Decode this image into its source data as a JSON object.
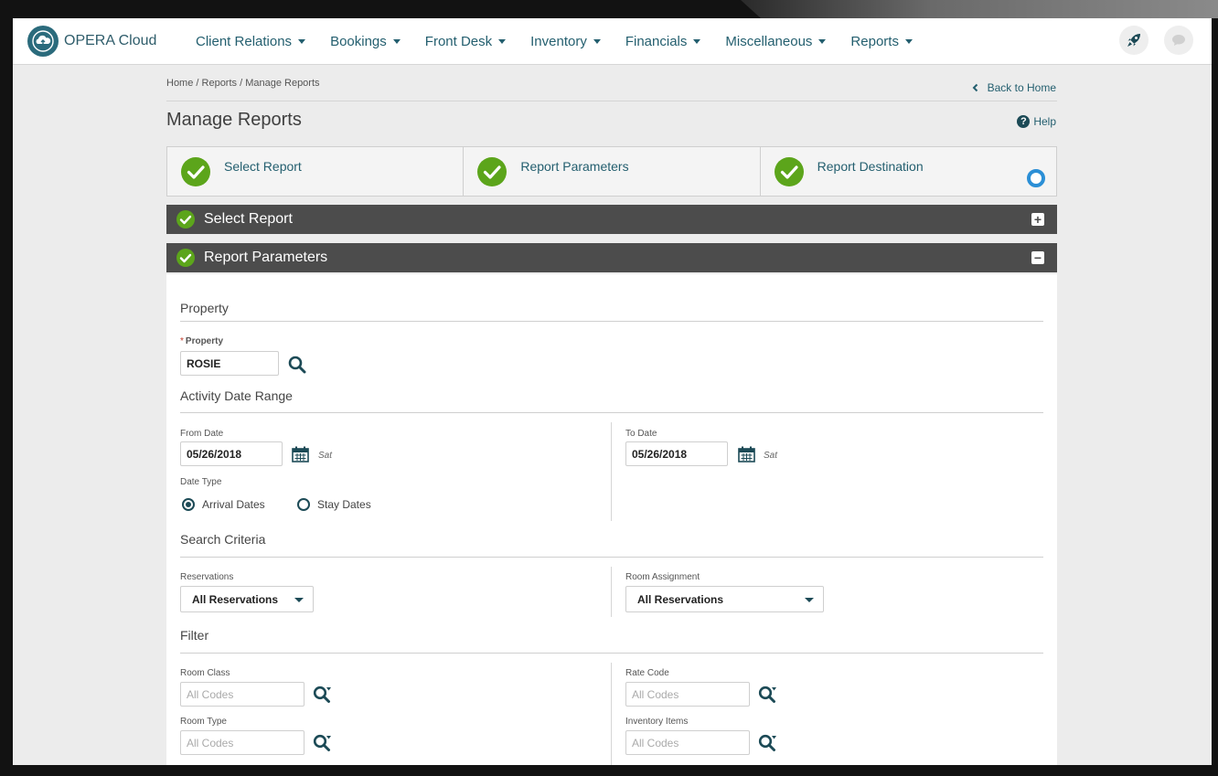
{
  "app": {
    "name": "OPERA Cloud"
  },
  "nav": {
    "items": [
      {
        "label": "Client Relations"
      },
      {
        "label": "Bookings"
      },
      {
        "label": "Front Desk"
      },
      {
        "label": "Inventory"
      },
      {
        "label": "Financials"
      },
      {
        "label": "Miscellaneous"
      },
      {
        "label": "Reports"
      }
    ],
    "icons": [
      "rocket-icon",
      "chat-icon"
    ]
  },
  "page": {
    "breadcrumb": "Home / Reports / Manage Reports",
    "back_link": "Back to Home",
    "title": "Manage Reports",
    "help": "Help"
  },
  "steps": [
    {
      "label": "Select Report",
      "status": "complete"
    },
    {
      "label": "Report Parameters",
      "status": "complete"
    },
    {
      "label": "Report Destination",
      "status": "complete"
    }
  ],
  "sections": {
    "select_report": {
      "label": "Select Report",
      "state": "collapsed"
    },
    "report_parameters": {
      "label": "Report Parameters",
      "state": "expanded"
    }
  },
  "form": {
    "property": {
      "heading": "Property",
      "label": "Property",
      "value": "ROSIE"
    },
    "activity": {
      "heading": "Activity Date Range",
      "from_label": "From Date",
      "from_value": "05/26/2018",
      "from_day": "Sat",
      "to_label": "To Date",
      "to_value": "05/26/2018",
      "to_day": "Sat",
      "date_type_label": "Date Type",
      "date_type_options": [
        "Arrival Dates",
        "Stay Dates"
      ],
      "date_type_selected": "Arrival Dates"
    },
    "search": {
      "heading": "Search Criteria",
      "reservations_label": "Reservations",
      "reservations_value": "All Reservations",
      "room_assignment_label": "Room Assignment",
      "room_assignment_value": "All Reservations"
    },
    "filter": {
      "heading": "Filter",
      "room_class_label": "Room Class",
      "room_class_placeholder": "All Codes",
      "rate_code_label": "Rate Code",
      "rate_code_placeholder": "All Codes",
      "room_type_label": "Room Type",
      "room_type_placeholder": "All Codes",
      "inventory_items_label": "Inventory Items",
      "inventory_items_placeholder": "All Codes"
    }
  },
  "colors": {
    "accent": "#245f6f",
    "success_green": "#5ca51b",
    "section_bar": "#4c4c4c",
    "step_indicator": "#2b8fd6"
  }
}
